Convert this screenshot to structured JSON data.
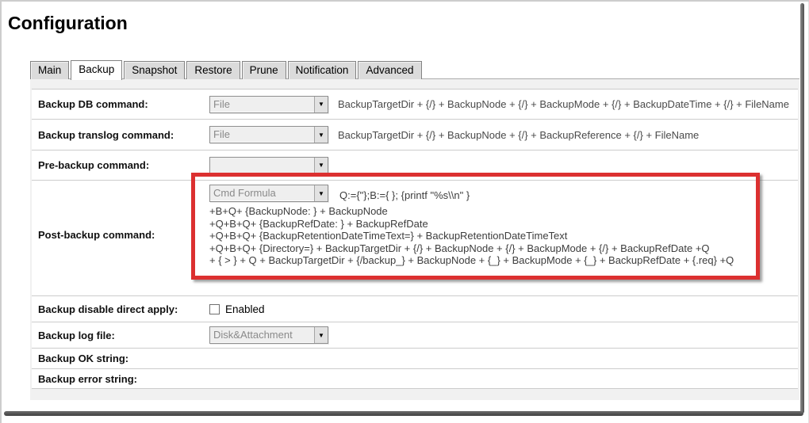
{
  "page": {
    "title": "Configuration"
  },
  "tabs": {
    "active": "Backup",
    "items": [
      {
        "label": "Main"
      },
      {
        "label": "Backup"
      },
      {
        "label": "Snapshot"
      },
      {
        "label": "Restore"
      },
      {
        "label": "Prune"
      },
      {
        "label": "Notification"
      },
      {
        "label": "Advanced"
      }
    ]
  },
  "form": {
    "backup_db": {
      "label": "Backup DB command:",
      "select_value": "File",
      "value_text": "BackupTargetDir + {/} + BackupNode + {/} + BackupMode + {/} + BackupDateTime + {/} + FileName"
    },
    "backup_translog": {
      "label": "Backup translog command:",
      "select_value": "File",
      "value_text": "BackupTargetDir + {/} + BackupNode + {/} + BackupReference + {/} + FileName"
    },
    "pre_backup": {
      "label": "Pre-backup command:",
      "select_value": ""
    },
    "post_backup": {
      "label": "Post-backup command:",
      "select_value": "Cmd Formula",
      "formula_line1": "Q:={\"};B:={ }; {printf \"%s\\\\n\" }",
      "formula_lines": [
        "+B+Q+ {BackupNode: } + BackupNode",
        "+Q+B+Q+ {BackupRefDate: } + BackupRefDate",
        "+Q+B+Q+ {BackupRetentionDateTimeText=} + BackupRetentionDateTimeText",
        "+Q+B+Q+ {Directory=} + BackupTargetDir + {/} + BackupNode + {/} + BackupMode + {/} + BackupRefDate +Q",
        "+ { > } + Q + BackupTargetDir + {/backup_} + BackupNode + {_} + BackupMode + {_} + BackupRefDate + {.req} +Q"
      ]
    },
    "disable_direct_apply": {
      "label": "Backup disable direct apply:",
      "checkbox_label": "Enabled",
      "checked": false
    },
    "log_file": {
      "label": "Backup log file:",
      "select_value": "Disk&Attachment"
    },
    "ok_string": {
      "label": "Backup OK string:"
    },
    "error_string": {
      "label": "Backup error string:"
    }
  },
  "icons": {
    "dropdown_arrow": "▼"
  },
  "colors": {
    "highlight_red": "#dc3030"
  }
}
